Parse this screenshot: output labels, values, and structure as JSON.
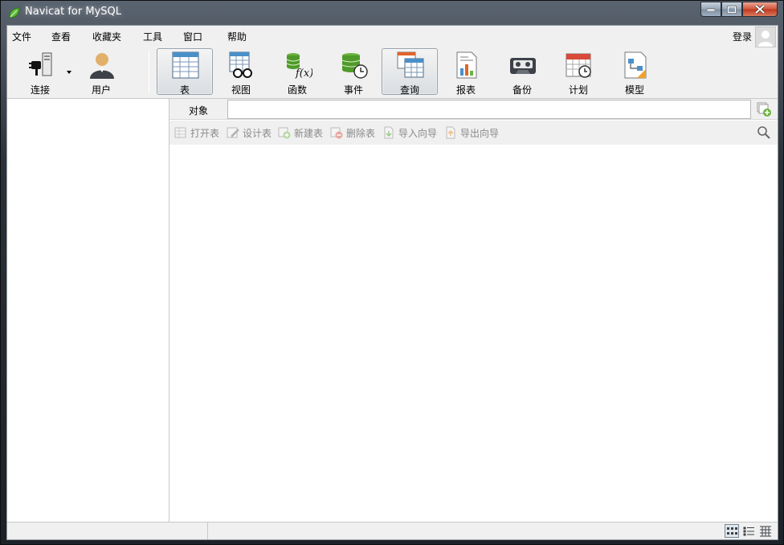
{
  "window": {
    "title": "Navicat for MySQL"
  },
  "menu": {
    "items": [
      "文件",
      "查看",
      "收藏夹",
      "工具",
      "窗口",
      "帮助"
    ],
    "login": "登录"
  },
  "toolbar": {
    "buttons": [
      {
        "label": "连接",
        "icon": "connection-icon"
      },
      {
        "label": "用户",
        "icon": "user-icon"
      },
      {
        "label": "表",
        "icon": "table-icon",
        "active": true
      },
      {
        "label": "视图",
        "icon": "view-icon"
      },
      {
        "label": "函数",
        "icon": "function-icon"
      },
      {
        "label": "事件",
        "icon": "event-icon"
      },
      {
        "label": "查询",
        "icon": "query-icon",
        "active": true
      },
      {
        "label": "报表",
        "icon": "report-icon"
      },
      {
        "label": "备份",
        "icon": "backup-icon"
      },
      {
        "label": "计划",
        "icon": "schedule-icon"
      },
      {
        "label": "模型",
        "icon": "model-icon"
      }
    ]
  },
  "object_bar": {
    "label": "对象",
    "value": ""
  },
  "actions": [
    "打开表",
    "设计表",
    "新建表",
    "删除表",
    "导入向导",
    "导出向导"
  ],
  "colors": {
    "accent": "#4a90c8",
    "disabled_text": "#8a8a8a"
  }
}
